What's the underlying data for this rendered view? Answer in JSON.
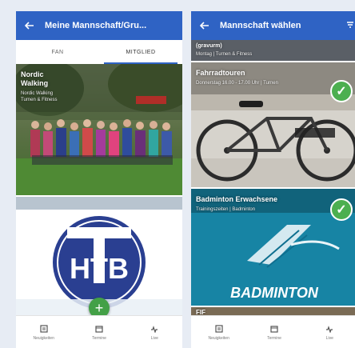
{
  "left_screen": {
    "appbar": {
      "title": "Meine Mannschaft/Gru..."
    },
    "tabs": [
      {
        "label": "FAN",
        "active": false
      },
      {
        "label": "MITGLIED",
        "active": true
      }
    ],
    "card1": {
      "title_line1": "Nordic",
      "title_line2": "Walking",
      "subtitle_line1": "Nordic Walking",
      "subtitle_line2": "Turnen & Fitness"
    },
    "card2": {
      "logo_text": "HTB"
    },
    "fab_label": "+",
    "nav": [
      {
        "label": "Neuigkeiten",
        "icon": "newspaper-icon"
      },
      {
        "label": "Termine",
        "icon": "calendar-icon"
      },
      {
        "label": "Live",
        "icon": "live-icon"
      }
    ]
  },
  "right_screen": {
    "appbar": {
      "title": "Mannschaft wählen"
    },
    "items": [
      {
        "title": "(gravurm)",
        "subtitle": "Montag | Turnen & Fitness",
        "checked": false
      },
      {
        "title": "Fahrradtouren",
        "subtitle": "Donnerstag 16.00 - 17.00 Uhr | Turnen",
        "checked": true
      },
      {
        "title": "Badminton Erwachsene",
        "subtitle": "Trainingszeiten | Badminton",
        "checked": true,
        "image_text": "BADMINTON"
      },
      {
        "title": "FIF",
        "subtitle": "",
        "checked": false
      }
    ],
    "nav": [
      {
        "label": "Neuigkeiten",
        "icon": "newspaper-icon"
      },
      {
        "label": "Termine",
        "icon": "calendar-icon"
      },
      {
        "label": "Live",
        "icon": "live-icon"
      }
    ]
  },
  "colors": {
    "appbar": "#2f63c4",
    "check": "#4caf50",
    "fab": "#43a047",
    "background": "#e7ecf4"
  }
}
